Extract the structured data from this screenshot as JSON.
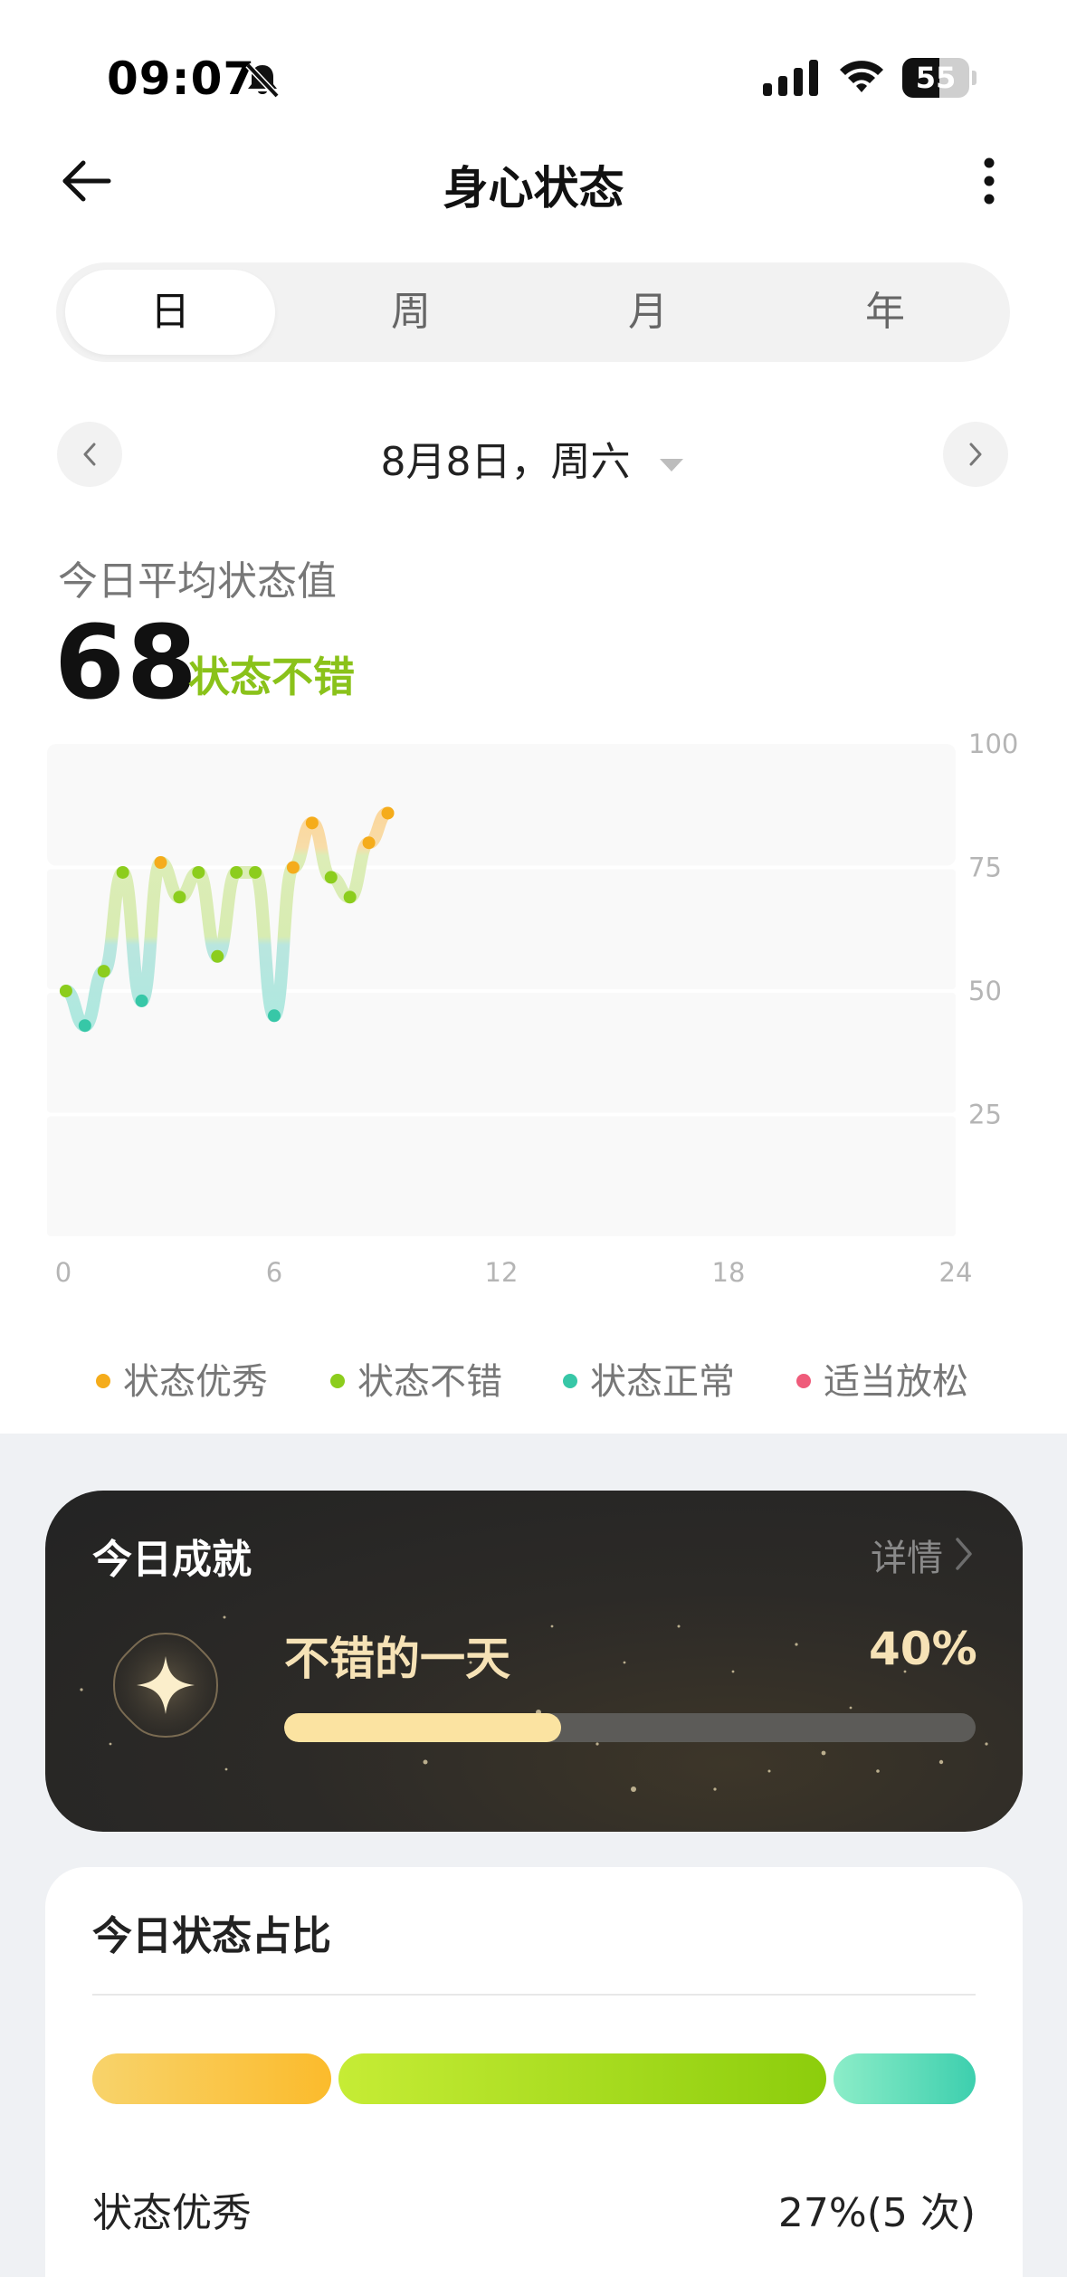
{
  "status_bar": {
    "time": "09:07",
    "battery": "55",
    "battery_level": 0.55,
    "bell_icon": "bell-slash-icon"
  },
  "nav": {
    "title": "身心状态"
  },
  "segments": {
    "tabs": [
      "日",
      "周",
      "月",
      "年"
    ],
    "active_index": 0
  },
  "date": {
    "label": "8月8日，周六"
  },
  "summary": {
    "avg_label": "今日平均状态值",
    "avg_value": "68",
    "avg_status": "状态不错"
  },
  "chart_data": {
    "type": "scatter",
    "x_ticks": [
      "0",
      "6",
      "12",
      "18",
      "24"
    ],
    "y_ticks": [
      "100",
      "75",
      "50",
      "25"
    ],
    "xlim": [
      0,
      24
    ],
    "ylim": [
      0,
      100
    ],
    "grid": "horizontal bands",
    "legend_position": "bottom",
    "points": [
      {
        "x": 0.5,
        "y": 50,
        "c": "good"
      },
      {
        "x": 1.0,
        "y": 43,
        "c": "normal"
      },
      {
        "x": 1.5,
        "y": 54,
        "c": "good"
      },
      {
        "x": 2.0,
        "y": 74,
        "c": "good"
      },
      {
        "x": 2.5,
        "y": 48,
        "c": "normal"
      },
      {
        "x": 3.0,
        "y": 76,
        "c": "excellent"
      },
      {
        "x": 3.5,
        "y": 69,
        "c": "good"
      },
      {
        "x": 4.0,
        "y": 74,
        "c": "good"
      },
      {
        "x": 4.5,
        "y": 57,
        "c": "good"
      },
      {
        "x": 5.0,
        "y": 74,
        "c": "good"
      },
      {
        "x": 5.5,
        "y": 74,
        "c": "good"
      },
      {
        "x": 6.0,
        "y": 45,
        "c": "normal"
      },
      {
        "x": 6.5,
        "y": 75,
        "c": "excellent"
      },
      {
        "x": 7.0,
        "y": 84,
        "c": "excellent"
      },
      {
        "x": 7.5,
        "y": 73,
        "c": "good"
      },
      {
        "x": 8.0,
        "y": 69,
        "c": "good"
      },
      {
        "x": 8.5,
        "y": 80,
        "c": "excellent"
      },
      {
        "x": 9.0,
        "y": 86,
        "c": "excellent"
      }
    ]
  },
  "legend": [
    {
      "label": "状态优秀",
      "color": "#f5ac1b"
    },
    {
      "label": "状态不错",
      "color": "#8ccd1d"
    },
    {
      "label": "状态正常",
      "color": "#37c7a7"
    },
    {
      "label": "适当放松",
      "color": "#ef5b7a"
    }
  ],
  "achievement": {
    "title": "今日成就",
    "detail": "详情",
    "name": "不错的一天",
    "percent": "40%",
    "progress": 0.4
  },
  "ratio": {
    "title": "今日状态占比",
    "segments": [
      {
        "name": "状态优秀",
        "share": 0.27,
        "from": "#f8d36b",
        "to": "#fbbb2c"
      },
      {
        "name": "状态不错",
        "share": 0.55,
        "from": "#c6ec35",
        "to": "#8ccd0c"
      },
      {
        "name": "状态正常",
        "share": 0.16,
        "from": "#8cedc8",
        "to": "#3dcfae"
      }
    ],
    "first_row": {
      "label": "状态优秀",
      "value": "27%(5 次)"
    }
  }
}
